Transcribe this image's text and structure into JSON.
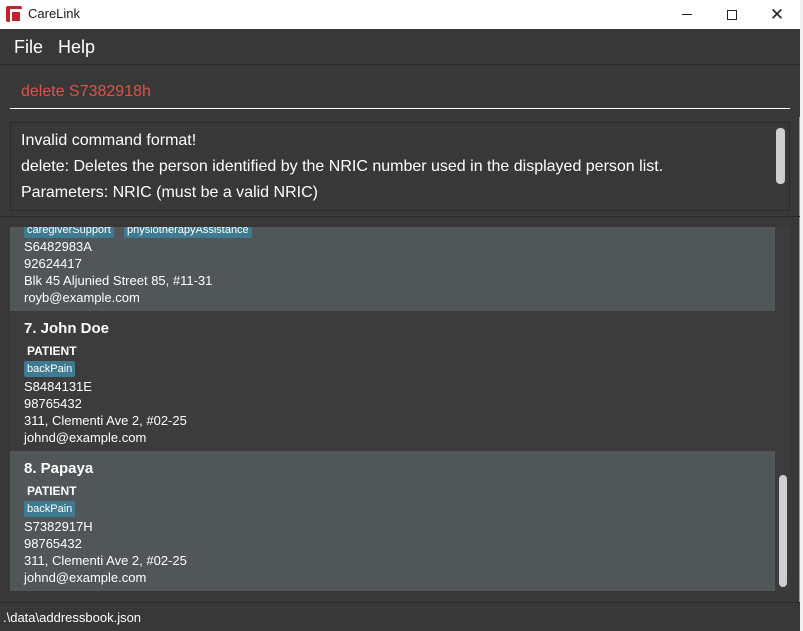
{
  "window": {
    "title": "CareLink",
    "app_icon": "carelink-app-icon",
    "close_glyph": "✕"
  },
  "menu": {
    "file": "File",
    "help": "Help"
  },
  "command": {
    "value": "delete S7382918h",
    "color": "#d9534a"
  },
  "result": {
    "lines": [
      "Invalid command format!",
      "delete: Deletes the person identified by the NRIC number used in the displayed person list.",
      "Parameters: NRIC (must be a valid NRIC)"
    ]
  },
  "persons": [
    {
      "tags": [
        "caregiverSupport",
        "physiotherapyAssistance"
      ],
      "nric": "S6482983A",
      "phone": "92624417",
      "address": "Blk 45 Aljunied Street 85, #11-31",
      "email": "royb@example.com"
    },
    {
      "title": "7. John Doe",
      "role": "PATIENT",
      "tags": [
        "backPain"
      ],
      "nric": "S8484131E",
      "phone": "98765432",
      "address": "311, Clementi Ave 2, #02-25",
      "email": "johnd@example.com"
    },
    {
      "title": "8. Papaya",
      "role": "PATIENT",
      "tags": [
        "backPain"
      ],
      "nric": "S7382917H",
      "phone": "98765432",
      "address": "311, Clementi Ave 2, #02-25",
      "email": "johnd@example.com"
    }
  ],
  "status": {
    "path": ".\\data\\addressbook.json"
  },
  "colors": {
    "background": "#383838",
    "tag": "#3e7b91",
    "selected_card": "#515658"
  }
}
